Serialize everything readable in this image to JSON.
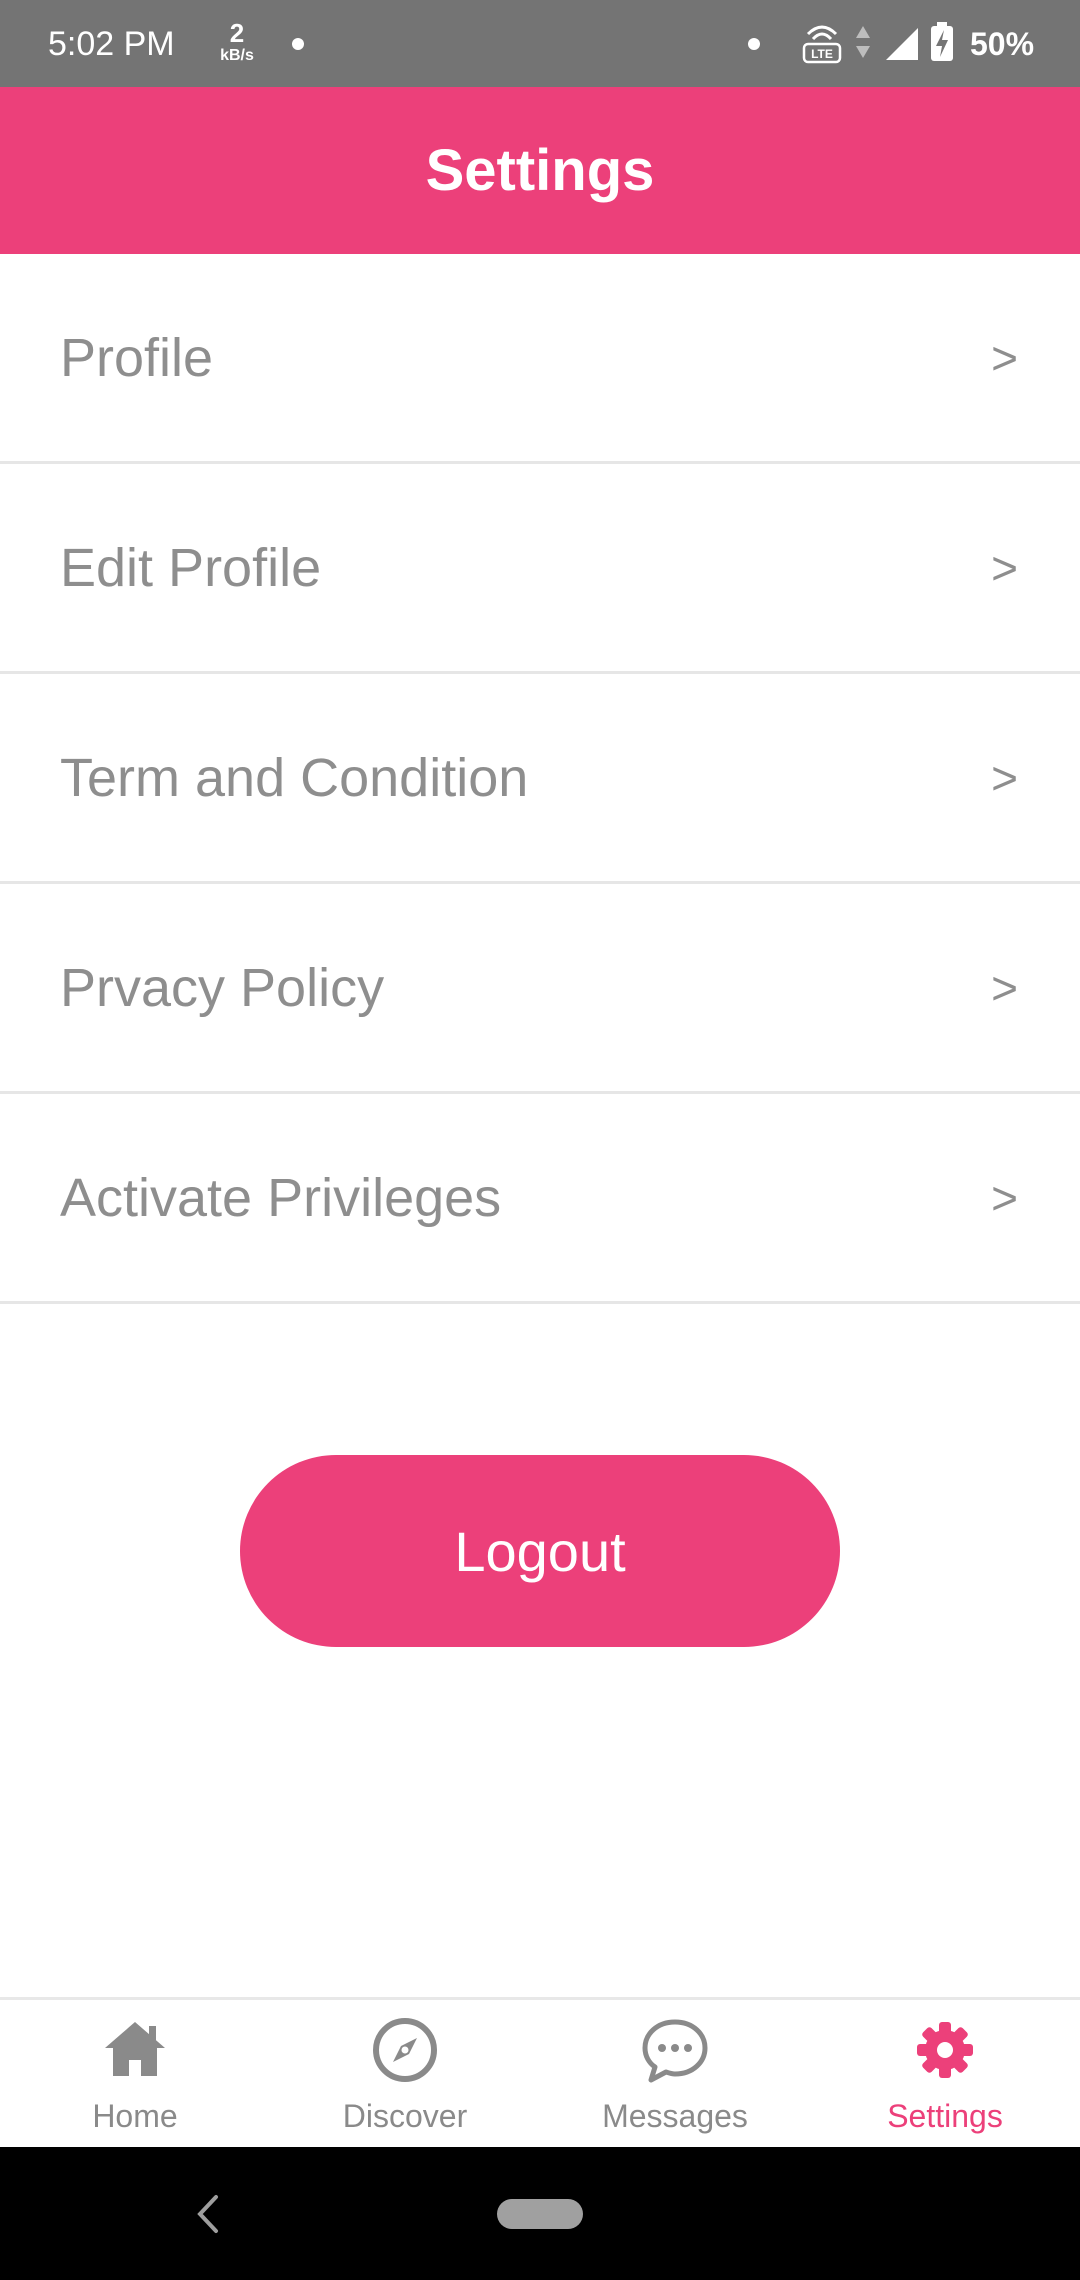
{
  "status_bar": {
    "time": "5:02 PM",
    "speed_value": "2",
    "speed_unit": "kB/s",
    "battery": "50%",
    "volte_text": "LTE"
  },
  "header": {
    "title": "Settings"
  },
  "settings_items": [
    {
      "label": "Profile",
      "chevron": ">"
    },
    {
      "label": "Edit Profile",
      "chevron": ">"
    },
    {
      "label": "Term and Condition",
      "chevron": ">"
    },
    {
      "label": "Prvacy Policy",
      "chevron": ">"
    },
    {
      "label": "Activate Privileges",
      "chevron": ">"
    }
  ],
  "logout_label": "Logout",
  "bottom_nav": {
    "items": [
      {
        "label": "Home",
        "icon": "home-icon"
      },
      {
        "label": "Discover",
        "icon": "compass-icon"
      },
      {
        "label": "Messages",
        "icon": "chat-bubble-icon"
      },
      {
        "label": "Settings",
        "icon": "gear-icon"
      }
    ],
    "active": "Settings"
  },
  "colors": {
    "accent": "#ec407a",
    "status_bar": "#747474",
    "text_gray": "#8e8e8e"
  }
}
